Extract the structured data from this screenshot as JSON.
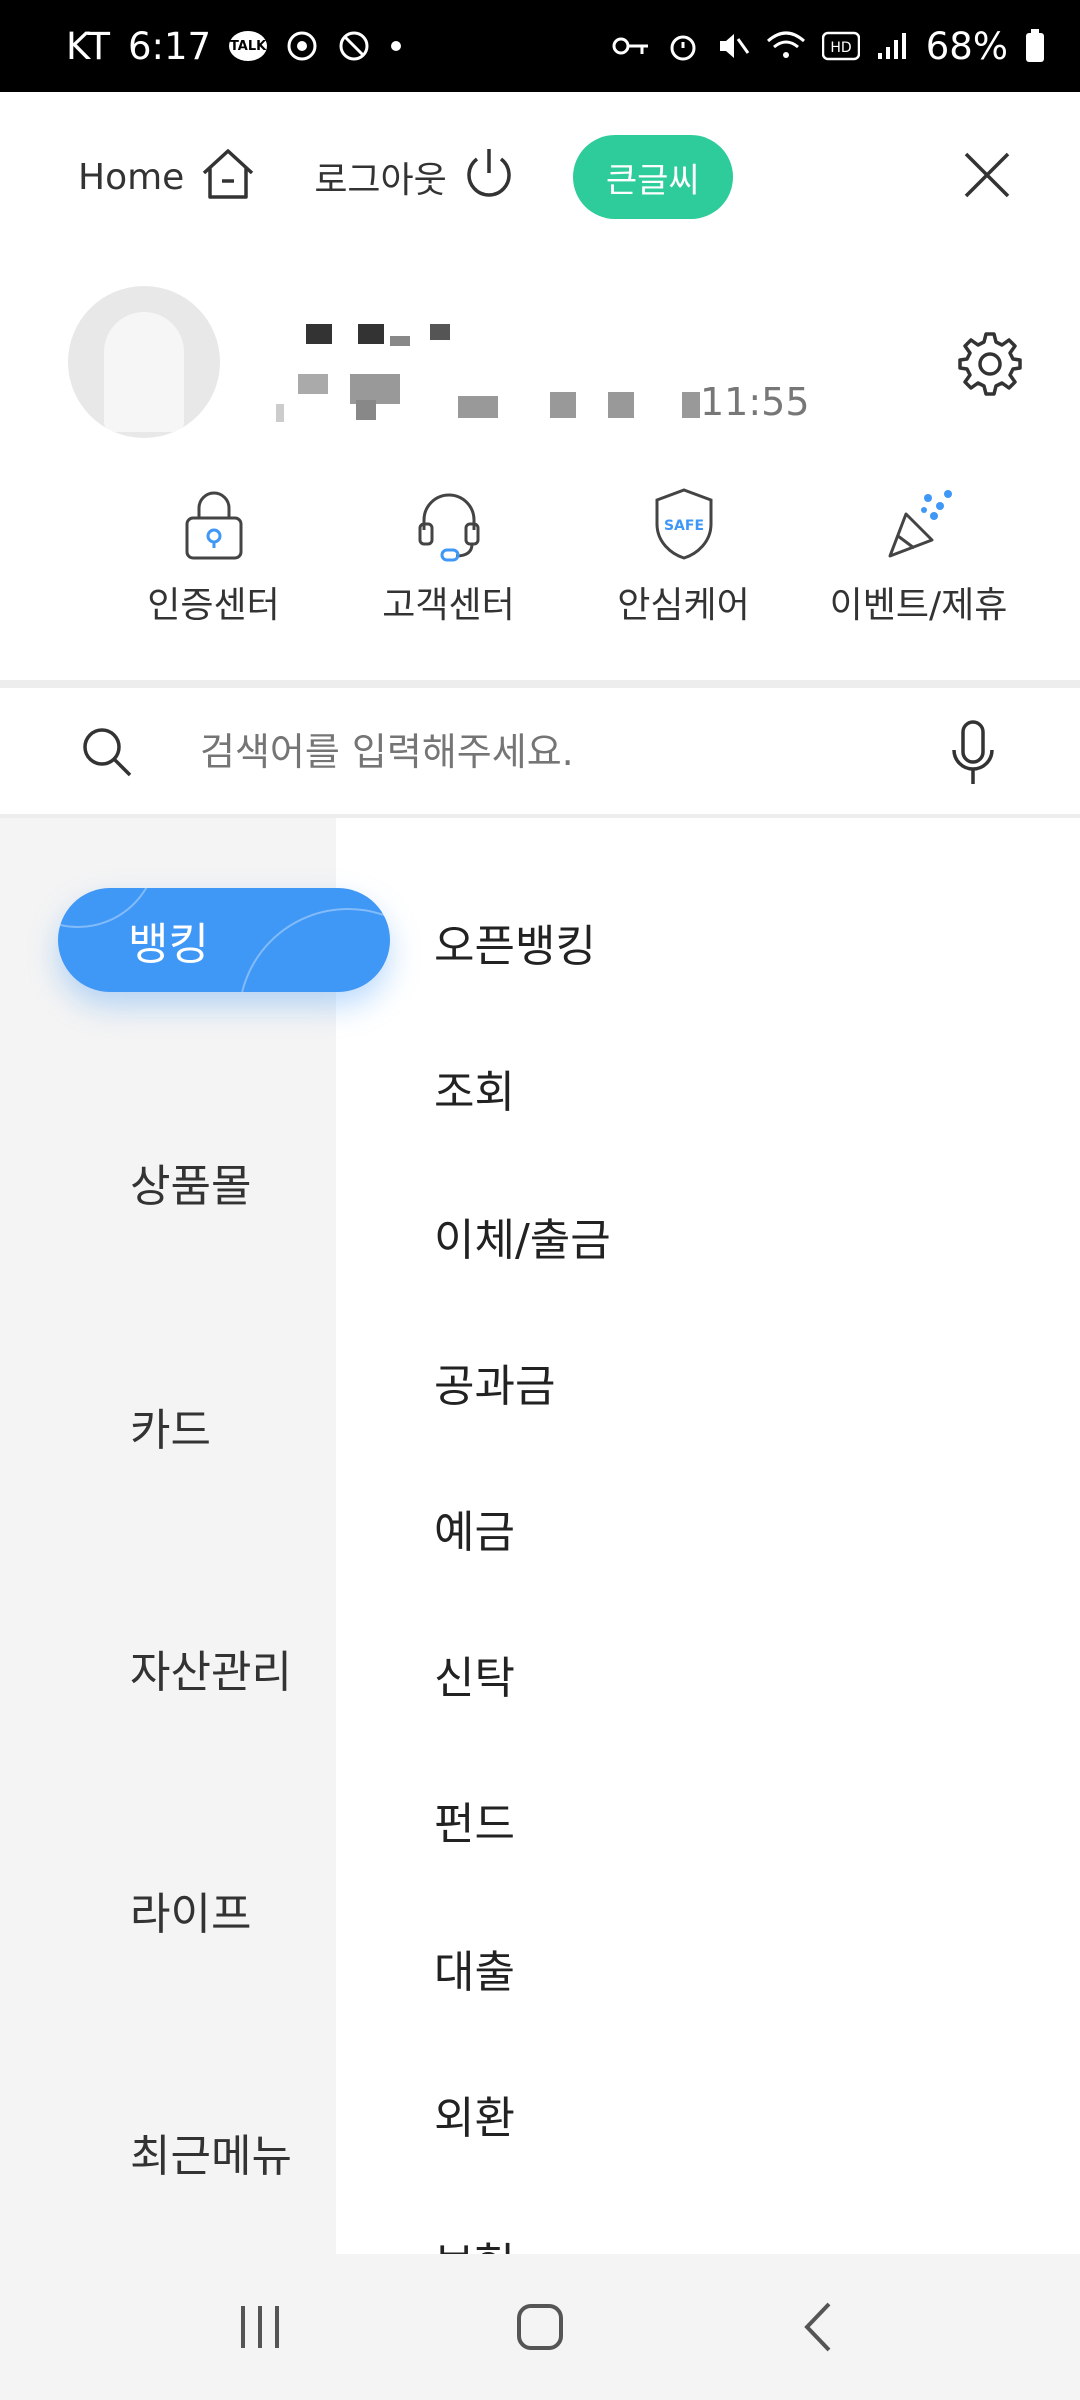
{
  "status_bar": {
    "carrier": "KT",
    "time": "6:17",
    "talk_badge": "TALK",
    "battery": "68%"
  },
  "header": {
    "home_label": "Home",
    "logout_label": "로그아웃",
    "big_text_label": "큰글씨"
  },
  "profile": {
    "last_login_time": "11:55"
  },
  "quick_menu": [
    {
      "label": "인증센터",
      "icon": "lock-icon"
    },
    {
      "label": "고객센터",
      "icon": "headset-icon"
    },
    {
      "label": "안심케어",
      "icon": "shield-safe-icon"
    },
    {
      "label": "이벤트/제휴",
      "icon": "party-popper-icon"
    }
  ],
  "shield_text": "SAFE",
  "search": {
    "placeholder": "검색어를 입력해주세요."
  },
  "left_nav": [
    {
      "label": "뱅킹",
      "active": true
    },
    {
      "label": "상품몰"
    },
    {
      "label": "카드"
    },
    {
      "label": "자산관리"
    },
    {
      "label": "라이프"
    },
    {
      "label": "최근메뉴"
    }
  ],
  "sub_menu": [
    "오픈뱅킹",
    "조회",
    "이체/출금",
    "공과금",
    "예금",
    "신탁",
    "펀드",
    "대출",
    "외환",
    "보험"
  ],
  "colors": {
    "accent_blue": "#3f97f6",
    "accent_green": "#2ecc9a"
  }
}
